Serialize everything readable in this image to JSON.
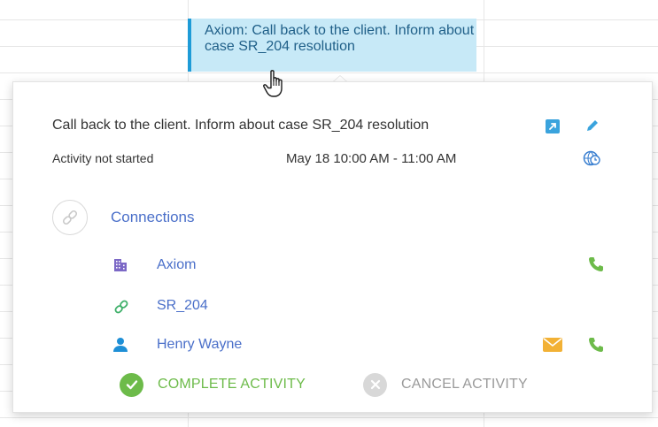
{
  "calendar_event": {
    "text": "Axiom: Call back to the client. Inform about case SR_204 resolution",
    "accent_color": "#1e9bd7",
    "background_color": "#c7e9f7"
  },
  "popup": {
    "title": "Call back to the client. Inform about case SR_204 resolution",
    "status": "Activity not started",
    "time_range": "May 18 10:00 AM - 11:00 AM",
    "icons": {
      "open": "open-in-new-icon",
      "edit": "pencil-icon",
      "timezone": "globe-clock-icon"
    }
  },
  "connections": {
    "title": "Connections",
    "items": [
      {
        "icon": "building-icon",
        "label": "Axiom",
        "actions": [
          "phone-icon"
        ]
      },
      {
        "icon": "link-icon",
        "label": "SR_204",
        "actions": []
      },
      {
        "icon": "person-icon",
        "label": "Henry Wayne",
        "actions": [
          "email-icon",
          "phone-icon"
        ]
      }
    ]
  },
  "actions": {
    "complete": "COMPLETE ACTIVITY",
    "cancel": "CANCEL ACTIVITY",
    "complete_color": "#6dbb4a",
    "cancel_color": "#9a9a9a"
  }
}
